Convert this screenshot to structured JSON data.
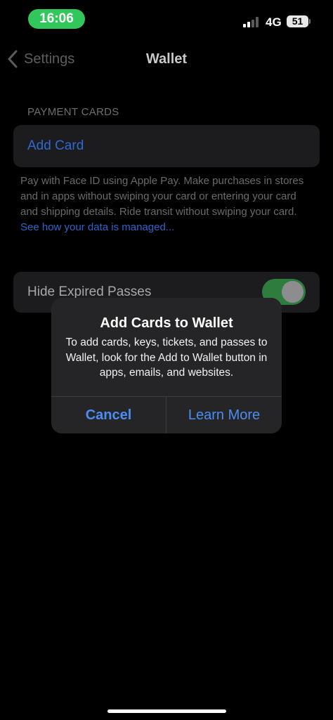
{
  "status_bar": {
    "time": "16:06",
    "network": "4G",
    "battery": "51",
    "time_pill_color": "#32c75a"
  },
  "nav": {
    "back_label": "Settings",
    "title": "Wallet"
  },
  "payment_cards": {
    "header": "PAYMENT CARDS",
    "add_card_label": "Add Card",
    "footer_text": "Pay with Face ID using Apple Pay. Make purchases in stores and in apps without swiping your card or entering your card and shipping details. Ride transit without swiping your card. ",
    "footer_link": "See how your data is managed..."
  },
  "hide_expired": {
    "label": "Hide Expired Passes",
    "toggle_on": true
  },
  "alert": {
    "title": "Add Cards to Wallet",
    "message": "To add cards, keys, tickets, and passes to Wallet, look for the Add to Wallet button in apps, emails, and websites.",
    "cancel_label": "Cancel",
    "learn_more_label": "Learn More",
    "button_color": "#4a8df3"
  },
  "colors": {
    "background": "#000000",
    "group_background": "#1c1c1e",
    "link_blue": "#2e6ad1",
    "toggle_green": "#2e7d3e"
  }
}
